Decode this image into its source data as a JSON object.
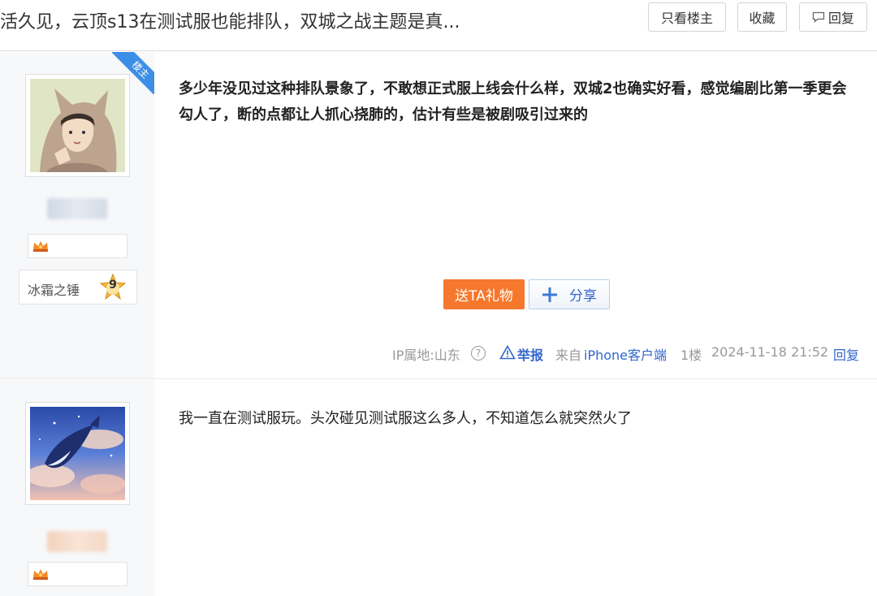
{
  "header": {
    "title": "活久见，云顶s13在测试服也能排队，双城之战主题是真...",
    "only_op_label": "只看楼主",
    "favorite_label": "收藏",
    "reply_label": "回复"
  },
  "posts": [
    {
      "op_tag": "楼主",
      "level_name": "冰霜之锤",
      "level_num": "9",
      "content": "多少年没见过这种排队景象了，不敢想正式服上线会什么样，双城2也确实好看，感觉编剧比第一季更会勾人了，断的点都让人抓心挠肺的，估计有些是被剧吸引过来的",
      "gift_label": "送TA礼物",
      "share_label": "分享",
      "ip_label": "IP属地:山东",
      "report_label": "举报",
      "from_label": "来自",
      "client_label": "iPhone客户端",
      "floor": "1楼",
      "time": "2024-11-18 21:52",
      "reply_label": "回复"
    },
    {
      "content": "我一直在测试服玩。头次碰见测试服这么多人，不知道怎么就突然火了"
    }
  ],
  "colors": {
    "accent_blue": "#3366cc",
    "gift_orange": "#f5782d",
    "op_ribbon": "#3d8ee6"
  }
}
